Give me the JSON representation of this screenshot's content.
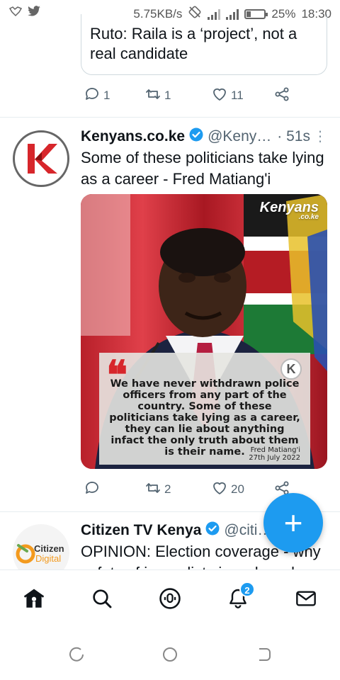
{
  "status_bar": {
    "speed": "5.75KB/s",
    "battery": "25%",
    "battery_level": 0.25,
    "time": "18:30",
    "left_icons": [
      "fox-icon",
      "twitter-bird-icon"
    ],
    "right_icons": [
      "no-rotate-icon",
      "signal-icon",
      "signal-4g-icon",
      "battery-icon"
    ]
  },
  "prev_tweet": {
    "quote_text": "Ruto: Raila is a ‘project’, not a real candidate",
    "replies": "1",
    "retweets": "1",
    "likes": "11"
  },
  "tweet": {
    "name": "Kenyans.co.ke",
    "handle": "@Keny…",
    "time": "· 51s",
    "text": "Some of these politicians take lying as a career - Fred Matiang'i",
    "media": {
      "brand": "Kenyans",
      "brand_sub": ".co.ke",
      "quote_mark": "❝",
      "quote_logo": "K",
      "quote": "We have never withdrawn police officers from any part of the country. Some of these politicians take lying as a career, they can lie about anything infact the only truth about them is their name.",
      "author": "Fred Matiang'i",
      "date": "27th July 2022"
    },
    "replies": "",
    "retweets": "2",
    "likes": "20"
  },
  "next_tweet": {
    "name": "Citizen TV Kenya",
    "handle": "@citi…",
    "text": "OPINION: Election coverage - why safety of journalists is a shared",
    "avatar_line1": "Citizen",
    "avatar_line2": "Digital"
  },
  "fab": {
    "label": "+"
  },
  "bottom_nav": {
    "items": [
      "home-icon",
      "search-icon",
      "spaces-icon",
      "notifications-icon",
      "messages-icon"
    ],
    "notifications_badge": "2"
  },
  "colors": {
    "accent": "#1d9bf0",
    "text": "#0f1419",
    "muted": "#536471",
    "brand_red": "#d7262b"
  }
}
